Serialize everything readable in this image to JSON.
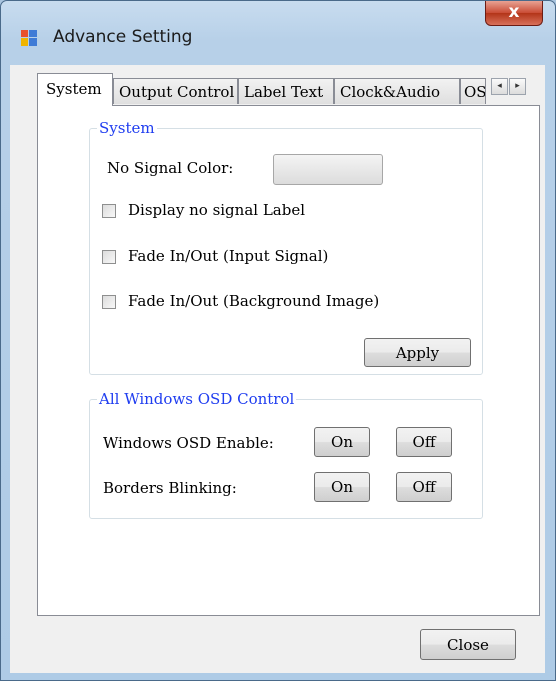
{
  "window": {
    "title": "Advance Setting",
    "close_glyph": "x"
  },
  "tabs": [
    {
      "label": "System",
      "active": true
    },
    {
      "label": "Output Control"
    },
    {
      "label": "Label Text"
    },
    {
      "label": "Clock&Audio"
    },
    {
      "label": "OS"
    }
  ],
  "tab_scroll": {
    "left": "◂",
    "right": "▸"
  },
  "system_group": {
    "title": "System",
    "no_signal_color_label": "No Signal Color:",
    "options": [
      {
        "label": "Display no signal Label",
        "checked": false
      },
      {
        "label": "Fade In/Out (Input Signal)",
        "checked": false
      },
      {
        "label": "Fade In/Out (Background Image)",
        "checked": false
      }
    ],
    "apply_label": "Apply"
  },
  "osd_group": {
    "title": "All Windows OSD Control",
    "rows": [
      {
        "label": "Windows OSD Enable:",
        "on": "On",
        "off": "Off"
      },
      {
        "label": "Borders Blinking:",
        "on": "On",
        "off": "Off"
      }
    ]
  },
  "footer": {
    "close_label": "Close"
  },
  "colors": {
    "accent_legend": "#1f3df0",
    "close_button": "#c94b34"
  }
}
